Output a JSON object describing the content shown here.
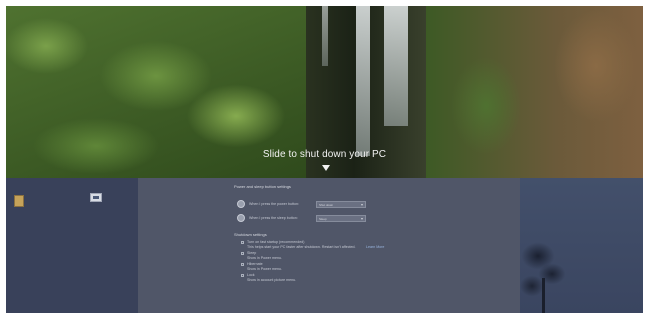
{
  "lock_screen": {
    "slide_prompt": "Slide to shut down your PC",
    "arrow_icon": "arrow-down-icon"
  },
  "desktop": {
    "left_tile_label": "",
    "folder_icon": "folder-icon",
    "window_icon": "window-icon"
  },
  "settings": {
    "section_title": "Power and sleep button settings",
    "power_button_label": "When I press the power button:",
    "power_button_value": "Shut down",
    "sleep_button_label": "When I press the sleep button:",
    "sleep_button_value": "Sleep",
    "shutdown_section_title": "Shutdown settings",
    "fast_startup_label": "Turn on fast startup (recommended)",
    "fast_startup_desc": "This helps start your PC faster after shutdown. Restart isn't affected.",
    "learn_more": "Learn More",
    "sleep_label": "Sleep",
    "sleep_desc": "Show in Power menu.",
    "hibernate_label": "Hibernate",
    "hibernate_desc": "Show in Power menu.",
    "lock_label": "Lock",
    "lock_desc": "Show in account picture menu."
  }
}
